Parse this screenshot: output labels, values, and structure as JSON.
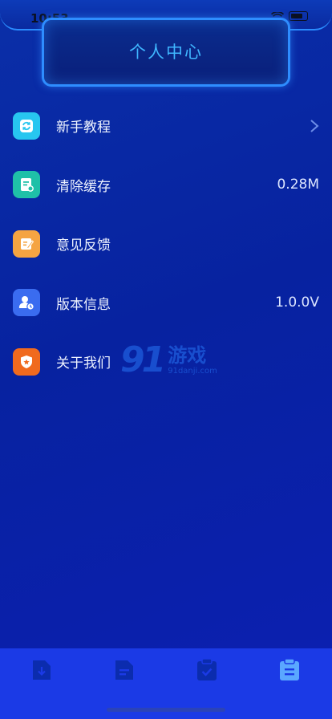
{
  "status_bar": {
    "time": "10:53"
  },
  "header": {
    "title": "个人中心"
  },
  "menu": {
    "items": [
      {
        "label": "新手教程",
        "value": "",
        "icon": "refresh-icon",
        "color": "#27c6f0"
      },
      {
        "label": "清除缓存",
        "value": "0.28M",
        "icon": "document-clear-icon",
        "color": "#1fc0a8"
      },
      {
        "label": "意见反馈",
        "value": "",
        "icon": "feedback-edit-icon",
        "color": "#f5a442"
      },
      {
        "label": "版本信息",
        "value": "1.0.0V",
        "icon": "user-clock-icon",
        "color": "#3a6cf0"
      },
      {
        "label": "关于我们",
        "value": "",
        "icon": "shield-star-icon",
        "color": "#f06a1e"
      }
    ]
  },
  "watermark": {
    "brand": "91",
    "name": "游戏",
    "url": "91danji.com"
  },
  "tab_bar": {
    "tabs": [
      {
        "icon": "download-document-icon",
        "active": false
      },
      {
        "icon": "document-list-icon",
        "active": false
      },
      {
        "icon": "clipboard-check-icon",
        "active": false
      },
      {
        "icon": "clipboard-list-icon",
        "active": true
      }
    ],
    "active_color": "#5aa7ff",
    "inactive_color": "#0b2cae"
  }
}
